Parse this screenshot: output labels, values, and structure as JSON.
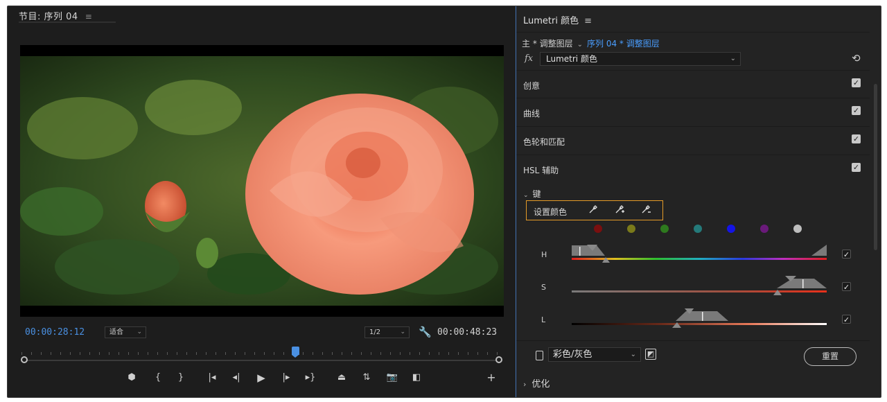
{
  "monitor": {
    "title": "节目: 序列 04",
    "menu_icon": "hamburger-icon",
    "timecode_current": "00:00:28:12",
    "fit_label": "适合",
    "resolution_label": "1/2",
    "timecode_duration": "00:00:48:23",
    "accent_color": "#4a90e2",
    "playhead_position": 0.57,
    "transport_icons": [
      "add-marker-icon",
      "mark-in-icon",
      "mark-out-icon",
      "go-to-in-icon",
      "step-back-icon",
      "play-icon",
      "step-forward-icon",
      "go-to-out-icon",
      "lift-icon",
      "extract-icon",
      "export-frame-icon",
      "comparison-view-icon",
      "add-button-icon"
    ]
  },
  "lumetri": {
    "title": "Lumetri 颜色",
    "menu_icon": "hamburger-icon",
    "breadcrumb": {
      "master": "主 * 调整图层",
      "active": "序列 04 * 调整图层"
    },
    "fx_label": "fx",
    "effect_name": "Lumetri 颜色",
    "sections": [
      {
        "label": "创意",
        "checked": true
      },
      {
        "label": "曲线",
        "checked": true
      },
      {
        "label": "色轮和匹配",
        "checked": true
      },
      {
        "label": "HSL 辅助",
        "checked": true
      }
    ],
    "key_label": "键",
    "set_color_label": "设置颜色",
    "set_color_border": "#e69b27",
    "eyedroppers": [
      "eyedropper-icon",
      "eyedropper-add-icon",
      "eyedropper-subtract-icon"
    ],
    "swatches": [
      "#7a0f0f",
      "#7a7a1a",
      "#2e7a1e",
      "#247a7a",
      "#1414e6",
      "#6a1a7a",
      "#bdbdbd"
    ],
    "hsl": [
      {
        "letter": "H",
        "checked": true
      },
      {
        "letter": "S",
        "checked": true
      },
      {
        "letter": "L",
        "checked": true
      }
    ],
    "mono_select": "彩色/灰色",
    "reset_label": "重置",
    "optimize_label": "优化"
  }
}
